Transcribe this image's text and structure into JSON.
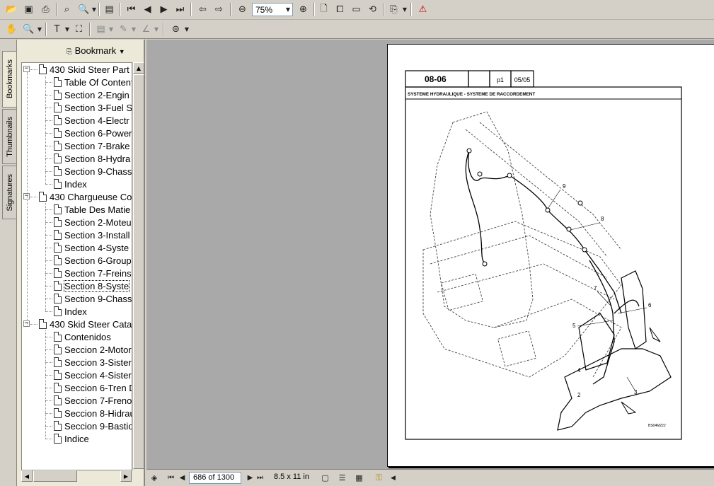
{
  "toolbar": {
    "zoom_value": "75%"
  },
  "side_tabs": [
    "Bookmarks",
    "Thumbnails",
    "Signatures"
  ],
  "bookmarks_panel": {
    "options_label": "Bookmark",
    "groups": [
      {
        "title": "430 Skid Steer Part",
        "items": [
          "Table Of Content",
          "Section 2-Engin",
          "Section 3-Fuel S",
          "Section 4-Electr",
          "Section 6-Power",
          "Section 7-Brake",
          "Section 8-Hydra",
          "Section 9-Chass",
          "Index"
        ]
      },
      {
        "title": "430 Chargueuse Co",
        "items": [
          "Table Des Matie",
          "Section 2-Moteu",
          "Section 3-Install",
          "Section 4-Syste",
          "Section 6-Group",
          "Section 7-Freins",
          "Section 8-Syste",
          "Section 9-Chass",
          "Index"
        ]
      },
      {
        "title": "430 Skid Steer Cata",
        "items": [
          "Contenidos",
          "Seccion 2-Motor",
          "Seccion 3-Sister",
          "Seccion 4-Sister",
          "Seccion 6-Tren D",
          "Seccion 7-Freno",
          "Seccion 8-Hidrau",
          "Seccion 9-Bastic",
          "Indice"
        ]
      }
    ]
  },
  "document": {
    "header_section": "08-06",
    "header_blank": "",
    "header_page": "p1",
    "header_date": "05/05",
    "subtitle": "SYSTEME HYDRAULIQUE - SYSTEME DE RACCORDEMENT",
    "callouts": [
      "2",
      "3",
      "4",
      "5",
      "6",
      "7",
      "8",
      "9"
    ],
    "figure_id": "BS04M222"
  },
  "status": {
    "page_indicator": "686 of 1300",
    "page_size": "8.5 x 11 in"
  }
}
